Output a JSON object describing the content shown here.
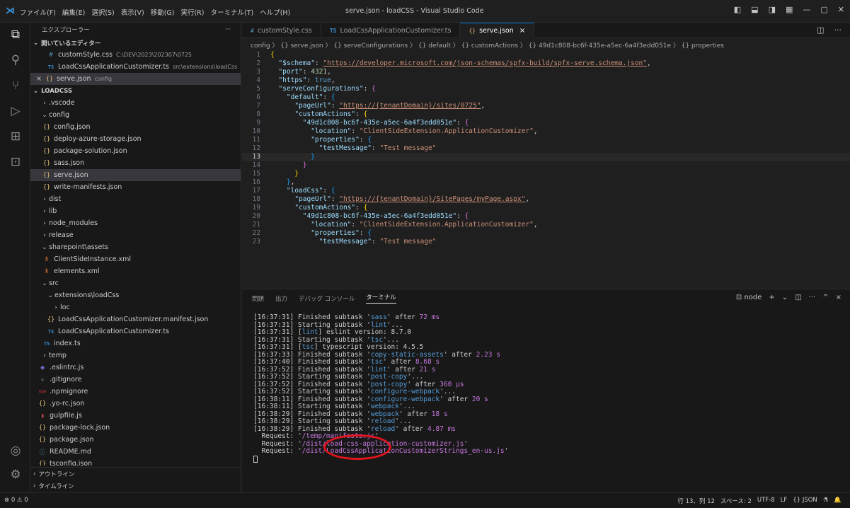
{
  "titlebar": {
    "logo": "⋊",
    "menu": [
      "ファイル(F)",
      "編集(E)",
      "選択(S)",
      "表示(V)",
      "移動(G)",
      "実行(R)",
      "ターミナル(T)",
      "ヘルプ(H)"
    ],
    "title": "serve.json - loadCSS - Visual Studio Code"
  },
  "sidebar": {
    "header": "エクスプローラー",
    "more": "···",
    "open_editors_label": "開いているエディター",
    "open_editors": [
      {
        "icon": "#",
        "kind": "css",
        "name": "customStyle.css",
        "desc": "C:\\DEV\\2023\\202307\\0725"
      },
      {
        "icon": "TS",
        "kind": "ts",
        "name": "LoadCssApplicationCustomizer.ts",
        "desc": "src\\extensions\\loadCss"
      },
      {
        "icon": "{}",
        "kind": "json",
        "name": "serve.json",
        "desc": "config",
        "close": "×"
      }
    ],
    "project_label": "LOADCSS",
    "tree": [
      {
        "chev": "›",
        "kind": "",
        "icon": "",
        "name": ".vscode",
        "indent": 14
      },
      {
        "chev": "⌄",
        "kind": "",
        "icon": "",
        "name": "config",
        "indent": 14
      },
      {
        "chev": "",
        "kind": "json",
        "icon": "{}",
        "name": "config.json",
        "indent": 16
      },
      {
        "chev": "",
        "kind": "json",
        "icon": "{}",
        "name": "deploy-azure-storage.json",
        "indent": 16
      },
      {
        "chev": "",
        "kind": "json",
        "icon": "{}",
        "name": "package-solution.json",
        "indent": 16
      },
      {
        "chev": "",
        "kind": "json",
        "icon": "{}",
        "name": "sass.json",
        "indent": 16
      },
      {
        "chev": "",
        "kind": "json",
        "icon": "{}",
        "name": "serve.json",
        "indent": 16,
        "selected": true
      },
      {
        "chev": "",
        "kind": "json",
        "icon": "{}",
        "name": "write-manifests.json",
        "indent": 16
      },
      {
        "chev": "›",
        "kind": "",
        "icon": "",
        "name": "dist",
        "indent": 14
      },
      {
        "chev": "›",
        "kind": "",
        "icon": "",
        "name": "lib",
        "indent": 14
      },
      {
        "chev": "›",
        "kind": "",
        "icon": "",
        "name": "node_modules",
        "indent": 14
      },
      {
        "chev": "›",
        "kind": "",
        "icon": "",
        "name": "release",
        "indent": 14
      },
      {
        "chev": "⌄",
        "kind": "",
        "icon": "",
        "name": "sharepoint\\assets",
        "indent": 14
      },
      {
        "chev": "",
        "kind": "xml",
        "icon": "ƛ",
        "name": "ClientSideInstance.xml",
        "indent": 16
      },
      {
        "chev": "",
        "kind": "xml",
        "icon": "ƛ",
        "name": "elements.xml",
        "indent": 16
      },
      {
        "chev": "⌄",
        "kind": "",
        "icon": "",
        "name": "src",
        "indent": 14
      },
      {
        "chev": "⌄",
        "kind": "",
        "icon": "",
        "name": "extensions\\loadCss",
        "indent": 22
      },
      {
        "chev": "›",
        "kind": "",
        "icon": "",
        "name": "loc",
        "indent": 30
      },
      {
        "chev": "",
        "kind": "json",
        "icon": "{}",
        "name": "LoadCssApplicationCustomizer.manifest.json",
        "indent": 22
      },
      {
        "chev": "",
        "kind": "ts",
        "icon": "TS",
        "name": "LoadCssApplicationCustomizer.ts",
        "indent": 22
      },
      {
        "chev": "",
        "kind": "ts",
        "icon": "TS",
        "name": "index.ts",
        "indent": 16
      },
      {
        "chev": "›",
        "kind": "",
        "icon": "",
        "name": "temp",
        "indent": 14
      },
      {
        "chev": "",
        "kind": "esl",
        "icon": "◉",
        "name": ".eslintrc.js",
        "indent": 10
      },
      {
        "chev": "",
        "kind": "git",
        "icon": "◈",
        "name": ".gitignore",
        "indent": 10
      },
      {
        "chev": "",
        "kind": "npm",
        "icon": "npm",
        "name": ".npmignore",
        "indent": 10
      },
      {
        "chev": "",
        "kind": "json",
        "icon": "{}",
        "name": ".yo-rc.json",
        "indent": 10
      },
      {
        "chev": "",
        "kind": "gulp",
        "icon": "▮",
        "name": "gulpfile.js",
        "indent": 10
      },
      {
        "chev": "",
        "kind": "json",
        "icon": "{}",
        "name": "package-lock.json",
        "indent": 10
      },
      {
        "chev": "",
        "kind": "json",
        "icon": "{}",
        "name": "package.json",
        "indent": 10
      },
      {
        "chev": "",
        "kind": "info",
        "icon": "ⓘ",
        "name": "README.md",
        "indent": 10
      },
      {
        "chev": "",
        "kind": "json",
        "icon": "{}",
        "name": "tsconfig.json",
        "indent": 10
      }
    ],
    "outline_label": "アウトライン",
    "timeline_label": "タイムライン"
  },
  "tabs": [
    {
      "icon": "#",
      "kind": "css",
      "label": "customStyle.css"
    },
    {
      "icon": "TS",
      "kind": "ts",
      "label": "LoadCssApplicationCustomizer.ts"
    },
    {
      "icon": "{}",
      "kind": "json",
      "label": "serve.json",
      "active": true,
      "close": "×"
    }
  ],
  "breadcrumb": "config 〉 {} serve.json 〉 {} serveConfigurations 〉 {} default 〉 {} customActions 〉 {} 49d1c808-bc6f-435e-a5ec-6a4f3edd051e 〉 {} properties",
  "code_lines": [
    [
      [
        "p1",
        "{"
      ]
    ],
    [
      [
        "",
        "  "
      ],
      [
        "k",
        "\"$schema\""
      ],
      [
        "",
        ": "
      ],
      [
        "u",
        "\"https://developer.microsoft.com/json-schemas/spfx-build/spfx-serve.schema.json\""
      ],
      [
        "",
        ","
      ]
    ],
    [
      [
        "",
        "  "
      ],
      [
        "k",
        "\"port\""
      ],
      [
        "",
        ": "
      ],
      [
        "n",
        "4321"
      ],
      [
        "",
        ","
      ]
    ],
    [
      [
        "",
        "  "
      ],
      [
        "k",
        "\"https\""
      ],
      [
        "",
        ": "
      ],
      [
        "b",
        "true"
      ],
      [
        "",
        ","
      ]
    ],
    [
      [
        "",
        "  "
      ],
      [
        "k",
        "\"serveConfigurations\""
      ],
      [
        "",
        ": "
      ],
      [
        "p2",
        "{"
      ]
    ],
    [
      [
        "",
        "    "
      ],
      [
        "k",
        "\"default\""
      ],
      [
        "",
        ": "
      ],
      [
        "p3",
        "{"
      ]
    ],
    [
      [
        "",
        "      "
      ],
      [
        "k",
        "\"pageUrl\""
      ],
      [
        "",
        ": "
      ],
      [
        "u",
        "\"https://{tenantDomain}/sites/0725\""
      ],
      [
        "",
        ","
      ]
    ],
    [
      [
        "",
        "      "
      ],
      [
        "k",
        "\"customActions\""
      ],
      [
        "",
        ": "
      ],
      [
        "p1",
        "{"
      ]
    ],
    [
      [
        "",
        "        "
      ],
      [
        "k",
        "\"49d1c808-bc6f-435e-a5ec-6a4f3edd051e\""
      ],
      [
        "",
        ": "
      ],
      [
        "p2",
        "{"
      ]
    ],
    [
      [
        "",
        "          "
      ],
      [
        "k",
        "\"location\""
      ],
      [
        "",
        ": "
      ],
      [
        "s",
        "\"ClientSideExtension.ApplicationCustomizer\""
      ],
      [
        "",
        ","
      ]
    ],
    [
      [
        "",
        "          "
      ],
      [
        "k",
        "\"properties\""
      ],
      [
        "",
        ": "
      ],
      [
        "p3",
        "{"
      ]
    ],
    [
      [
        "",
        "            "
      ],
      [
        "k",
        "\"testMessage\""
      ],
      [
        "",
        ": "
      ],
      [
        "s",
        "\"Test message\""
      ]
    ],
    [
      [
        "",
        "          "
      ],
      [
        "p3",
        "}"
      ]
    ],
    [
      [
        "",
        "        "
      ],
      [
        "p2",
        "}"
      ]
    ],
    [
      [
        "",
        "      "
      ],
      [
        "p1",
        "}"
      ]
    ],
    [
      [
        "",
        "    "
      ],
      [
        "p3",
        "}"
      ],
      [
        "",
        ","
      ]
    ],
    [
      [
        "",
        "    "
      ],
      [
        "k",
        "\"loadCss\""
      ],
      [
        "",
        ": "
      ],
      [
        "p3",
        "{"
      ]
    ],
    [
      [
        "",
        "      "
      ],
      [
        "k",
        "\"pageUrl\""
      ],
      [
        "",
        ": "
      ],
      [
        "u",
        "\"https://{tenantDomain}/SitePages/myPage.aspx\""
      ],
      [
        "",
        ","
      ]
    ],
    [
      [
        "",
        "      "
      ],
      [
        "k",
        "\"customActions\""
      ],
      [
        "",
        ": "
      ],
      [
        "p1",
        "{"
      ]
    ],
    [
      [
        "",
        "        "
      ],
      [
        "k",
        "\"49d1c808-bc6f-435e-a5ec-6a4f3edd051e\""
      ],
      [
        "",
        ": "
      ],
      [
        "p2",
        "{"
      ]
    ],
    [
      [
        "",
        "          "
      ],
      [
        "k",
        "\"location\""
      ],
      [
        "",
        ": "
      ],
      [
        "s",
        "\"ClientSideExtension.ApplicationCustomizer\""
      ],
      [
        "",
        ","
      ]
    ],
    [
      [
        "",
        "          "
      ],
      [
        "k",
        "\"properties\""
      ],
      [
        "",
        ": "
      ],
      [
        "p3",
        "{"
      ]
    ],
    [
      [
        "",
        "            "
      ],
      [
        "k",
        "\"testMessage\""
      ],
      [
        "",
        ": "
      ],
      [
        "s",
        "\"Test message\""
      ]
    ]
  ],
  "panel": {
    "tabs": [
      "問題",
      "出力",
      "デバッグ コンソール",
      "ターミナル"
    ],
    "shell": "node",
    "actions": [
      "+",
      "⌄",
      "◫",
      "···",
      "^",
      "×"
    ]
  },
  "terminal": [
    [
      [
        "",
        "["
      ],
      [
        "",
        "16:37:31"
      ],
      [
        "",
        "] Finished subtask '"
      ],
      [
        "ts",
        "sass"
      ],
      [
        "",
        "' after "
      ],
      [
        "tm",
        "72 ms"
      ]
    ],
    [
      [
        "",
        "[16:37:31] Starting subtask '"
      ],
      [
        "ts",
        "lint"
      ],
      [
        "",
        "'..."
      ]
    ],
    [
      [
        "",
        "[16:37:31] ["
      ],
      [
        "ts",
        "lint"
      ],
      [
        "",
        "] eslint version: 8.7.0"
      ]
    ],
    [
      [
        "",
        "[16:37:31] Starting subtask '"
      ],
      [
        "ts",
        "tsc"
      ],
      [
        "",
        "'..."
      ]
    ],
    [
      [
        "",
        "[16:37:31] ["
      ],
      [
        "ts",
        "tsc"
      ],
      [
        "",
        "] typescript version: 4.5.5"
      ]
    ],
    [
      [
        "",
        "[16:37:33] Finished subtask '"
      ],
      [
        "ts",
        "copy-static-assets"
      ],
      [
        "",
        "' after "
      ],
      [
        "tm",
        "2.23 s"
      ]
    ],
    [
      [
        "",
        "[16:37:40] Finished subtask '"
      ],
      [
        "ts",
        "tsc"
      ],
      [
        "",
        "' after "
      ],
      [
        "tm",
        "8.68 s"
      ]
    ],
    [
      [
        "",
        "[16:37:52] Finished subtask '"
      ],
      [
        "ts",
        "lint"
      ],
      [
        "",
        "' after "
      ],
      [
        "tm",
        "21 s"
      ]
    ],
    [
      [
        "",
        "[16:37:52] Starting subtask '"
      ],
      [
        "ts",
        "post-copy"
      ],
      [
        "",
        "'..."
      ]
    ],
    [
      [
        "",
        "[16:37:52] Finished subtask '"
      ],
      [
        "ts",
        "post-copy"
      ],
      [
        "",
        "' after "
      ],
      [
        "tm",
        "360 μs"
      ]
    ],
    [
      [
        "",
        "[16:37:52] Starting subtask '"
      ],
      [
        "ts",
        "configure-webpack"
      ],
      [
        "",
        "'..."
      ]
    ],
    [
      [
        "",
        "[16:38:11] Finished subtask '"
      ],
      [
        "ts",
        "configure-webpack"
      ],
      [
        "",
        "' after "
      ],
      [
        "tm",
        "20 s"
      ]
    ],
    [
      [
        "",
        "[16:38:11] Starting subtask '"
      ],
      [
        "ts",
        "webpack"
      ],
      [
        "",
        "'..."
      ]
    ],
    [
      [
        "",
        "[16:38:29] Finished subtask '"
      ],
      [
        "ts",
        "webpack"
      ],
      [
        "",
        "' after "
      ],
      [
        "tm",
        "18 s"
      ]
    ],
    [
      [
        "",
        "[16:38:29] Starting subtask '"
      ],
      [
        "ts",
        "reload"
      ],
      [
        "",
        "'..."
      ]
    ],
    [
      [
        "",
        "[16:38:29] Finished subtask '"
      ],
      [
        "ts",
        "reload"
      ],
      [
        "",
        "' after "
      ],
      [
        "tm",
        "4.87 ms"
      ]
    ],
    [
      [
        "",
        "  Request: '"
      ],
      [
        "tm",
        "/temp/manifests.js"
      ],
      [
        "",
        "'"
      ]
    ],
    [
      [
        "",
        "  Request: '"
      ],
      [
        "tm",
        "/dist/load-css-application-customizer.js"
      ],
      [
        "",
        "'"
      ]
    ],
    [
      [
        "",
        "  Request: '"
      ],
      [
        "tm",
        "/dist/LoadCssApplicationCustomizerStrings_en-us.js"
      ],
      [
        "",
        "'"
      ]
    ]
  ],
  "statusbar": {
    "problems": "⊗ 0 ⚠ 0",
    "position": "行 13、列 12",
    "spaces": "スペース: 2",
    "encoding": "UTF-8",
    "eol": "LF",
    "language": "{} JSON"
  },
  "current_line": 13,
  "colors": {
    "accent": "#0078d4",
    "marker": "#e0151e"
  }
}
